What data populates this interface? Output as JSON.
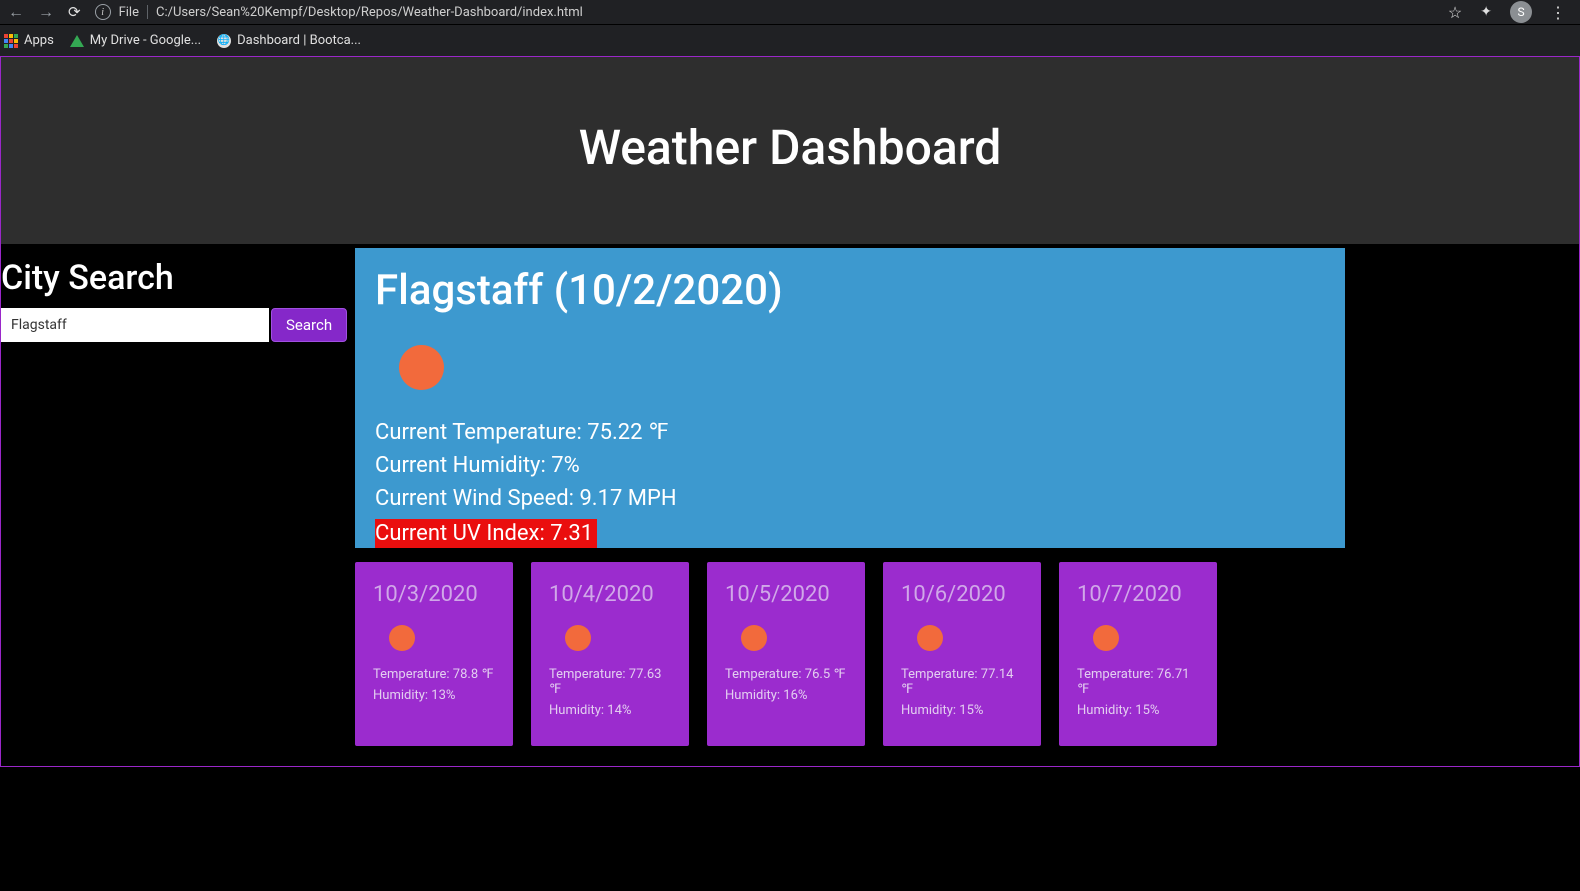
{
  "browser": {
    "url_prefix": "File",
    "url_path": "C:/Users/Sean%20Kempf/Desktop/Repos/Weather-Dashboard/index.html",
    "avatar_initial": "S",
    "bookmarks": {
      "apps": "Apps",
      "drive": "My Drive - Google...",
      "bootcamp": "Dashboard | Bootca..."
    }
  },
  "header": {
    "title": "Weather Dashboard"
  },
  "sidebar": {
    "heading": "City Search",
    "search_value": "Flagstaff",
    "search_button": "Search"
  },
  "current": {
    "city_date": "Flagstaff (10/2/2020)",
    "temp": "Current Temperature: 75.22 ℉",
    "humidity": "Current Humidity: 7%",
    "wind": "Current Wind Speed: 9.17 MPH",
    "uv": "Current UV Index: 7.31"
  },
  "forecast": [
    {
      "date": "10/3/2020",
      "temp": "Temperature: 78.8 ℉",
      "humidity": "Humidity: 13%"
    },
    {
      "date": "10/4/2020",
      "temp": "Temperature: 77.63 ℉",
      "humidity": "Humidity: 14%"
    },
    {
      "date": "10/5/2020",
      "temp": "Temperature: 76.5 ℉",
      "humidity": "Humidity: 16%"
    },
    {
      "date": "10/6/2020",
      "temp": "Temperature: 77.14 ℉",
      "humidity": "Humidity: 15%"
    },
    {
      "date": "10/7/2020",
      "temp": "Temperature: 76.71 ℉",
      "humidity": "Humidity: 15%"
    }
  ]
}
